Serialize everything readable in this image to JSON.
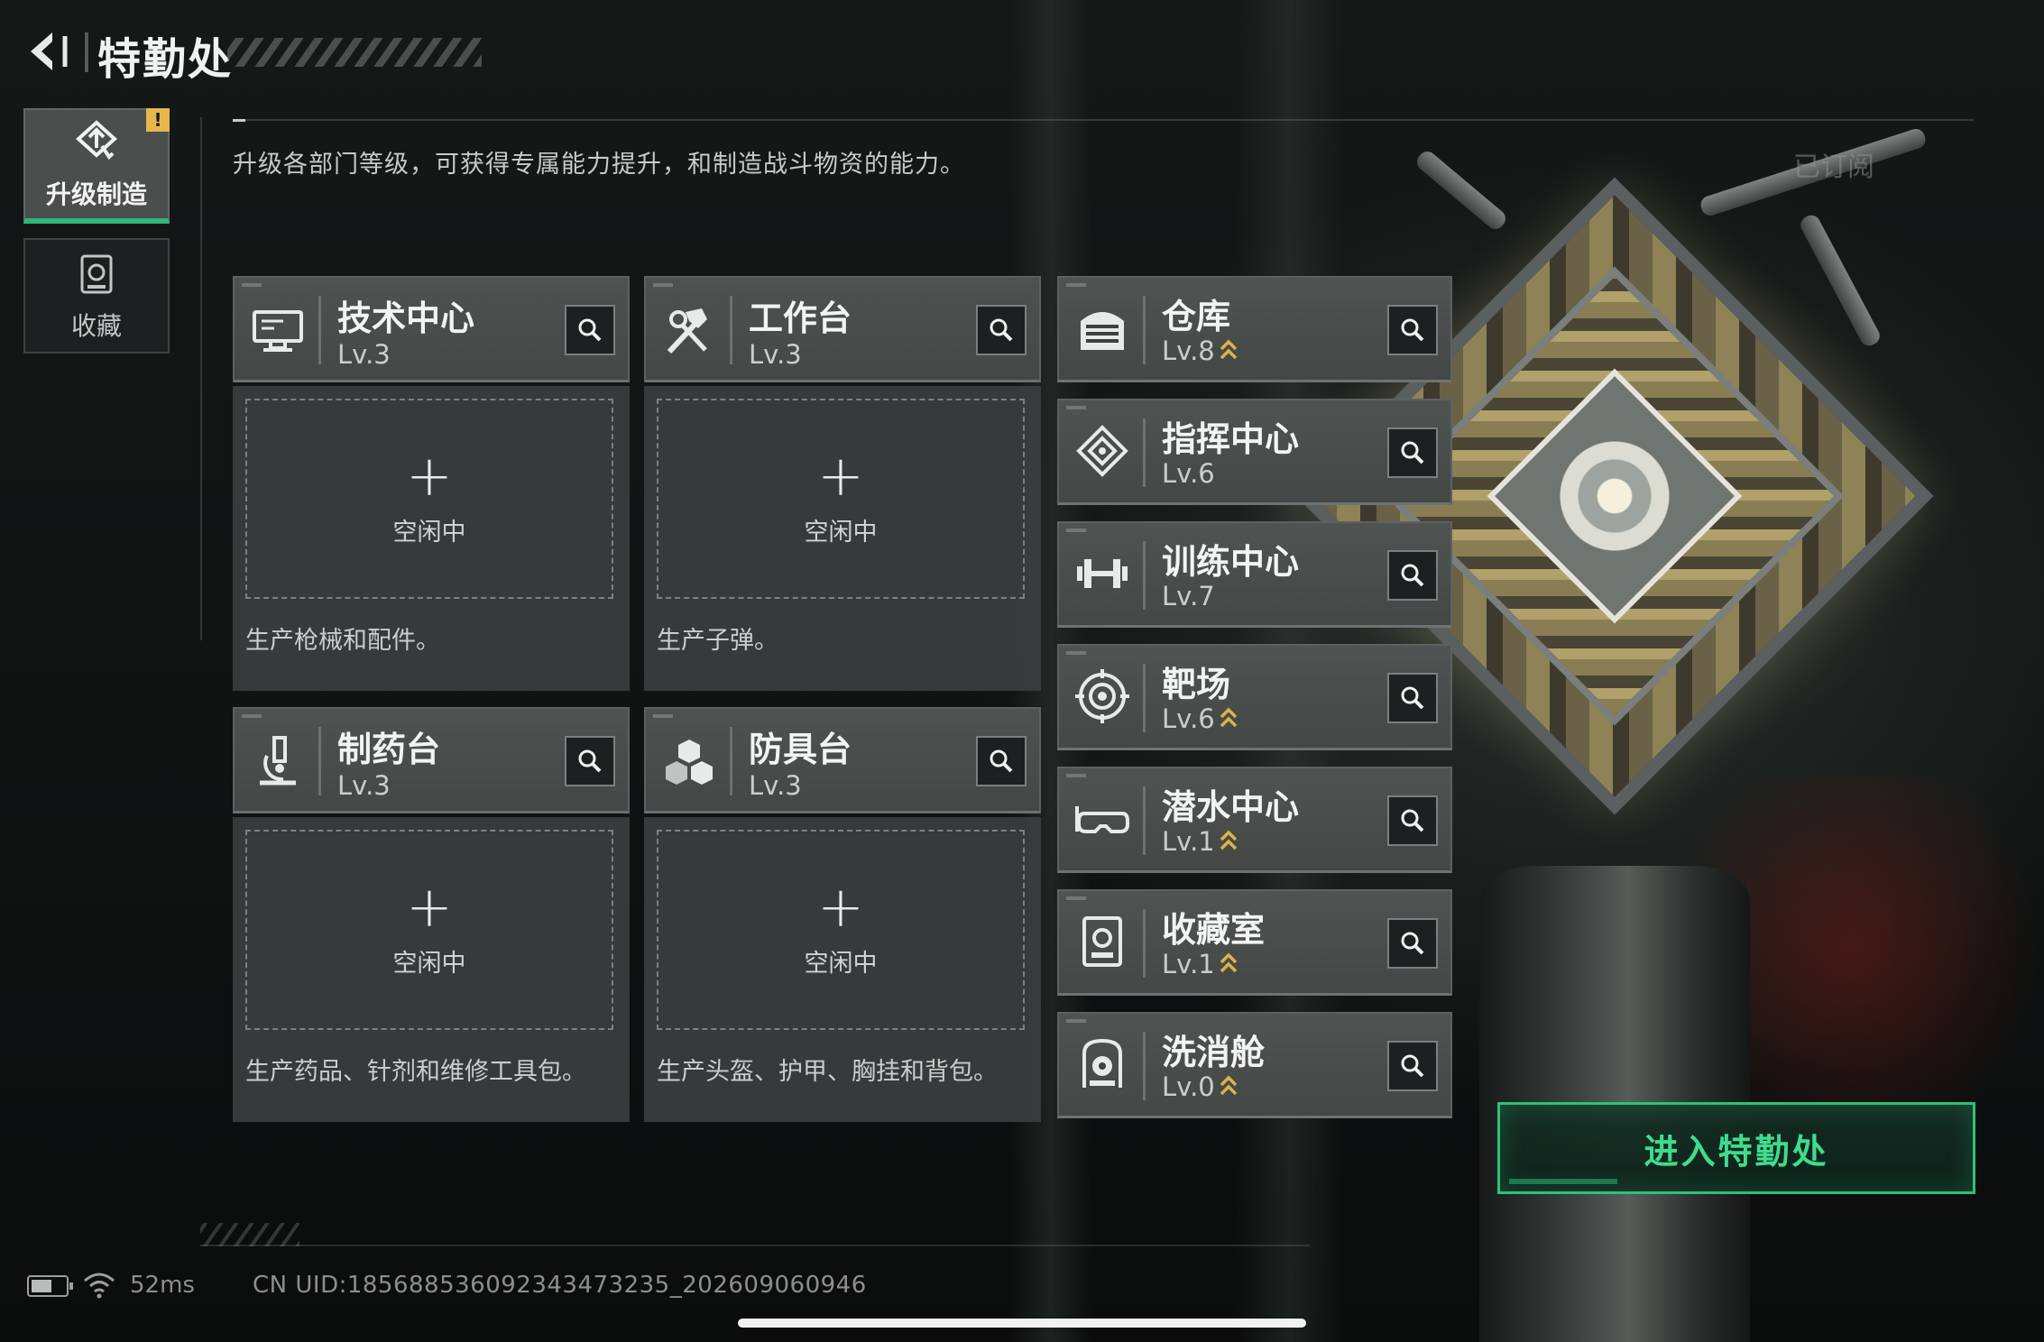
{
  "header": {
    "title": "特勤处"
  },
  "side_tabs": [
    {
      "label": "升级制造",
      "icon": "upgrade-icon",
      "active": true,
      "badge": "!"
    },
    {
      "label": "收藏",
      "icon": "collection-icon",
      "active": false
    }
  ],
  "description": "升级各部门等级，可获得专属能力提升，和制造战斗物资的能力。",
  "subscribed_label": "已订阅",
  "production_cards": [
    {
      "name": "技术中心",
      "level": "Lv.3",
      "icon": "monitor-icon",
      "slot_plus": "+",
      "slot_status": "空闲中",
      "desc": "生产枪械和配件。"
    },
    {
      "name": "工作台",
      "level": "Lv.3",
      "icon": "hammer-wrench-icon",
      "slot_plus": "+",
      "slot_status": "空闲中",
      "desc": "生产子弹。"
    },
    {
      "name": "制药台",
      "level": "Lv.3",
      "icon": "microscope-icon",
      "slot_plus": "+",
      "slot_status": "空闲中",
      "desc": "生产药品、针剂和维修工具包。"
    },
    {
      "name": "防具台",
      "level": "Lv.3",
      "icon": "armor-blocks-icon",
      "slot_plus": "+",
      "slot_status": "空闲中",
      "desc": "生产头盔、护甲、胸挂和背包。"
    }
  ],
  "facilities": [
    {
      "name": "仓库",
      "level": "Lv.8",
      "icon": "warehouse-icon",
      "upgradable": true
    },
    {
      "name": "指挥中心",
      "level": "Lv.6",
      "icon": "command-chip-icon",
      "upgradable": false
    },
    {
      "name": "训练中心",
      "level": "Lv.7",
      "icon": "dumbbell-icon",
      "upgradable": false
    },
    {
      "name": "靶场",
      "level": "Lv.6",
      "icon": "target-icon",
      "upgradable": true
    },
    {
      "name": "潜水中心",
      "level": "Lv.1",
      "icon": "diving-mask-icon",
      "upgradable": true
    },
    {
      "name": "收藏室",
      "level": "Lv.1",
      "icon": "collection-room-icon",
      "upgradable": true
    },
    {
      "name": "洗消舱",
      "level": "Lv.0",
      "icon": "decontamination-icon",
      "upgradable": true
    }
  ],
  "enter_button": "进入特勤处",
  "footer": {
    "ping": "52ms",
    "uid": "CN UID:185688536092343473235_202609060946",
    "battery_level": 0.6
  },
  "colors": {
    "accent_green": "#2ec17c",
    "upgrade_gold": "#e0b04a",
    "warning_badge": "#e6b84a"
  }
}
